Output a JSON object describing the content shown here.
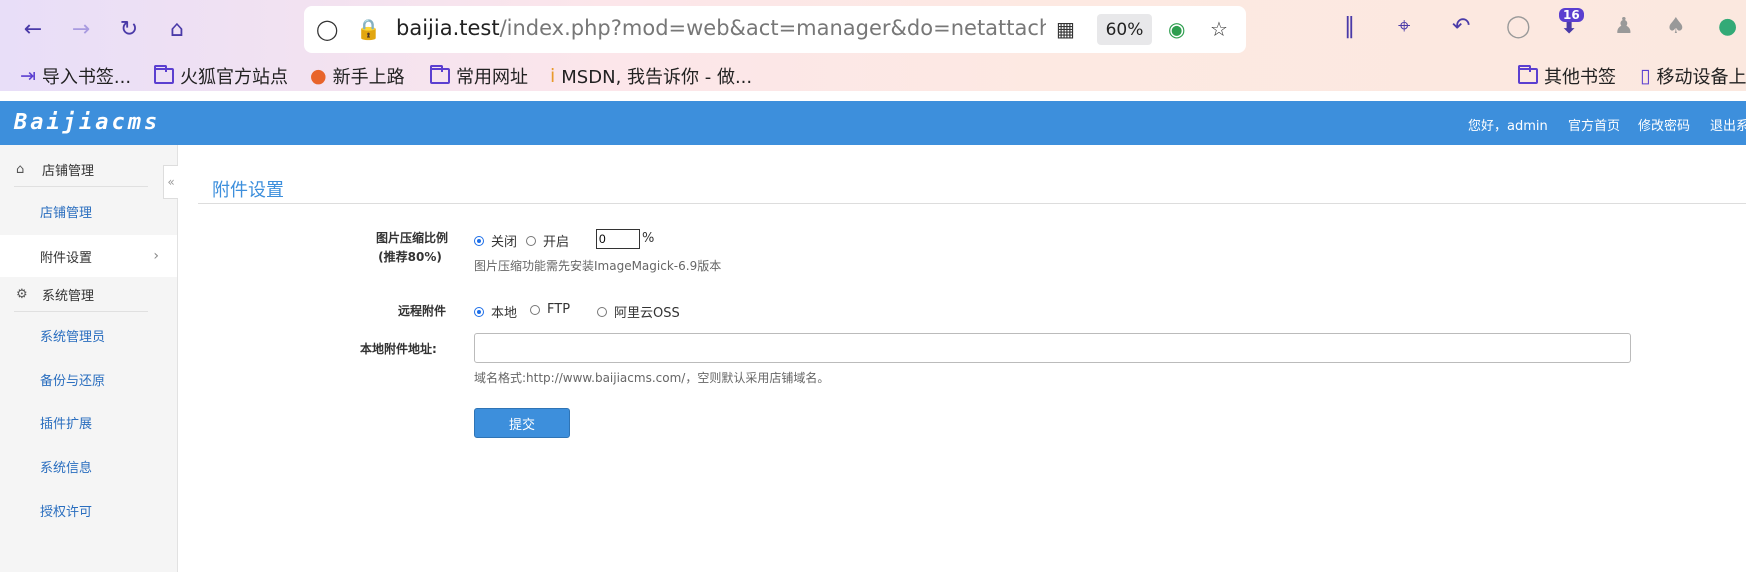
{
  "browser": {
    "url_host": "baijia.test",
    "url_path": "/index.php?mod=web&act=manager&do=netattach&b",
    "zoom": "60%",
    "download_badge": "16",
    "bookmarks": [
      {
        "label": "导入书签...",
        "icon": "import-icon"
      },
      {
        "label": "火狐官方站点",
        "icon": "folder-icon"
      },
      {
        "label": "新手上路",
        "icon": "firefox-icon"
      },
      {
        "label": "常用网址",
        "icon": "folder-icon"
      },
      {
        "label": "MSDN, 我告诉你 - 做...",
        "icon": "msdn-icon"
      }
    ],
    "bookmarks_right": [
      {
        "label": "其他书签",
        "icon": "folder-icon"
      },
      {
        "label": "移动设备上",
        "icon": "mobile-icon"
      }
    ]
  },
  "app": {
    "logo": "Baijiacms",
    "greeting": "您好，admin",
    "links": [
      "官方首页",
      "修改密码",
      "退出系"
    ]
  },
  "sidebar": {
    "sections": [
      {
        "title": "店铺管理",
        "icon": "home-icon",
        "items": [
          "店铺管理",
          "附件设置"
        ]
      },
      {
        "title": "系统管理",
        "icon": "gears-icon",
        "items": [
          "系统管理员",
          "备份与还原",
          "插件扩展",
          "系统信息",
          "授权许可"
        ]
      }
    ],
    "active_item": "附件设置"
  },
  "page": {
    "title": "附件设置",
    "compress": {
      "label_line1": "图片压缩比例",
      "label_line2": "(推荐80%)",
      "options": [
        "关闭",
        "开启"
      ],
      "selected": "关闭",
      "value": "0",
      "unit": "%",
      "help": "图片压缩功能需先安装ImageMagick-6.9版本"
    },
    "remote": {
      "label": "远程附件",
      "options": [
        "本地",
        "FTP",
        "阿里云OSS"
      ],
      "selected": "本地"
    },
    "local_url": {
      "label": "本地附件地址:",
      "value": "",
      "help": "域名格式:http://www.baijiacms.com/，空则默认采用店铺域名。"
    },
    "submit_label": "提交"
  }
}
